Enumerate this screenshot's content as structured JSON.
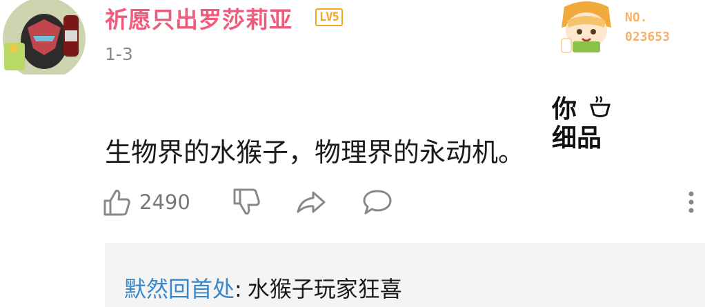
{
  "post": {
    "username": "祈愿只出罗莎莉亚",
    "level": "LV5",
    "floor": "1-3",
    "fan_badge": {
      "prefix": "NO.",
      "number": "023653"
    },
    "comment": "生物界的水猴子，物理界的永动机。",
    "sticker": {
      "line1": "你",
      "line2": "细品"
    },
    "like_count": "2490"
  },
  "reply": {
    "author": "默然回首处",
    "separator": ":",
    "text": "水猴子玩家狂喜"
  },
  "colors": {
    "username": "#f05a7b",
    "level_badge": "#f5a623",
    "fan_badge": "#f5b26a",
    "reply_author": "#3a86c8",
    "reply_bg": "#f4f4f4"
  }
}
